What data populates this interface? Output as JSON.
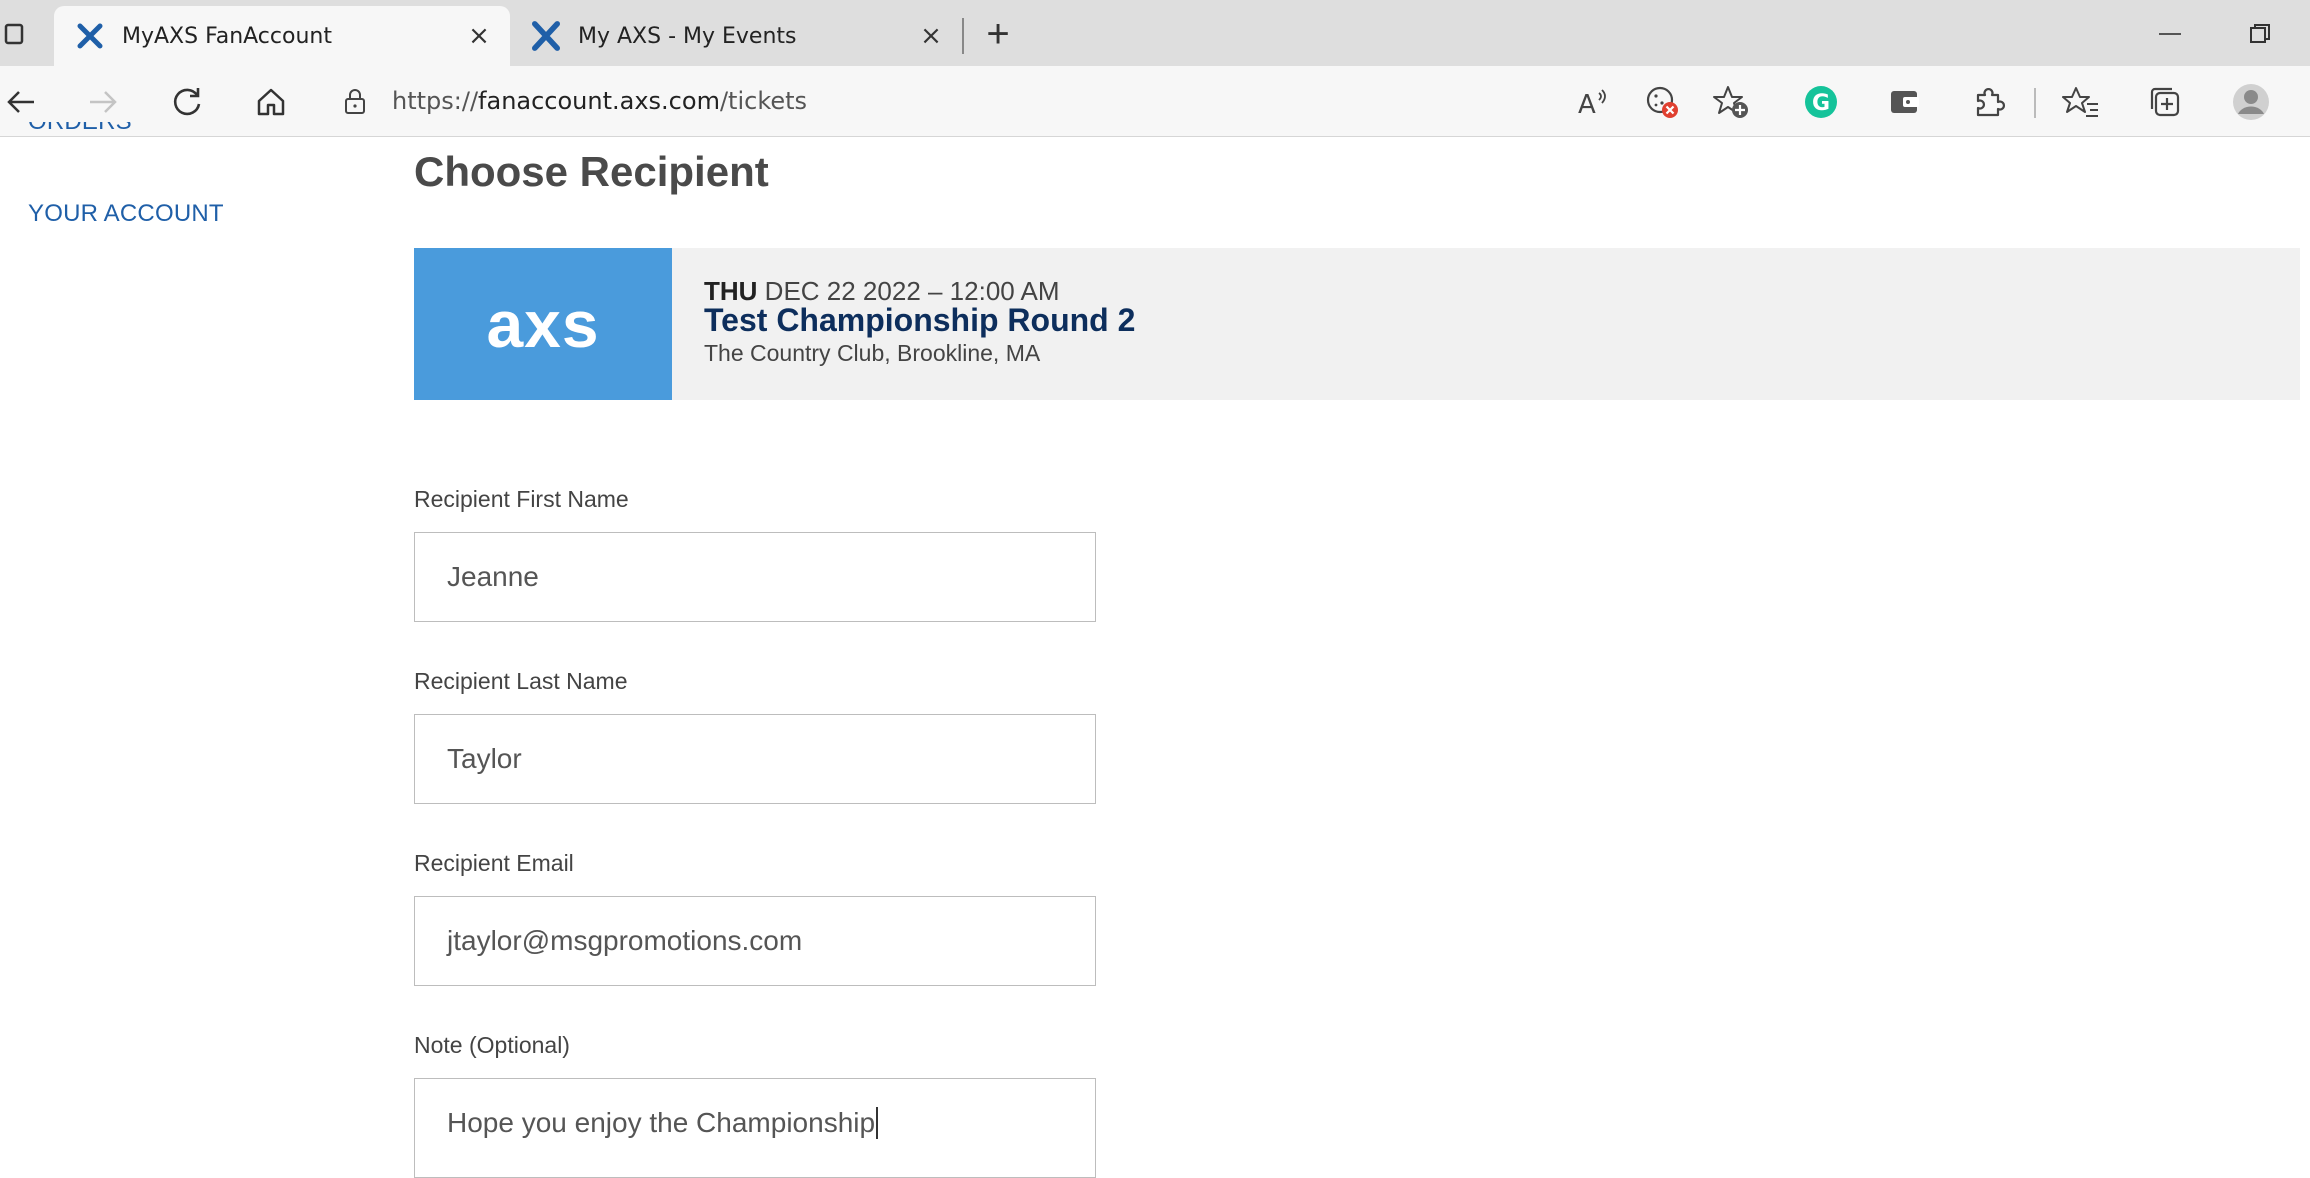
{
  "browser": {
    "tabs": [
      {
        "title": "MyAXS FanAccount",
        "active": true
      },
      {
        "title": "My AXS - My Events",
        "active": false
      }
    ],
    "close_glyph": "×",
    "new_tab_glyph": "+",
    "url_scheme": "https://",
    "url_host": "fanaccount.axs.com",
    "url_path": "/tickets",
    "icons": [
      "back-icon",
      "forward-icon",
      "refresh-icon",
      "home-icon",
      "lock-icon",
      "read-aloud-icon",
      "cookie-blocked-icon",
      "add-favorite-icon",
      "grammarly-icon",
      "wallet-icon",
      "extensions-icon",
      "favorites-icon",
      "collections-icon",
      "profile-icon"
    ]
  },
  "sidebar": {
    "orders_label": "ORDERS",
    "account_label": "YOUR ACCOUNT"
  },
  "page": {
    "title": "Choose Recipient"
  },
  "event": {
    "logo_text": "axs",
    "day": "THU",
    "date_time": "DEC 22 2022 – 12:00 AM",
    "name": "Test Championship Round 2",
    "venue": "The Country Club, Brookline, MA"
  },
  "form": {
    "first_name": {
      "label": "Recipient First Name",
      "value": "Jeanne"
    },
    "last_name": {
      "label": "Recipient Last Name",
      "value": "Taylor"
    },
    "email": {
      "label": "Recipient Email",
      "value": "jtaylor@msgpromotions.com"
    },
    "note": {
      "label": "Note (Optional)",
      "value": "Hope you enjoy the Championship"
    }
  },
  "colors": {
    "link": "#1f5fa8",
    "logo_bg": "#4a9bdc",
    "event_name": "#0d2e5c",
    "grammarly": "#15c39a"
  }
}
